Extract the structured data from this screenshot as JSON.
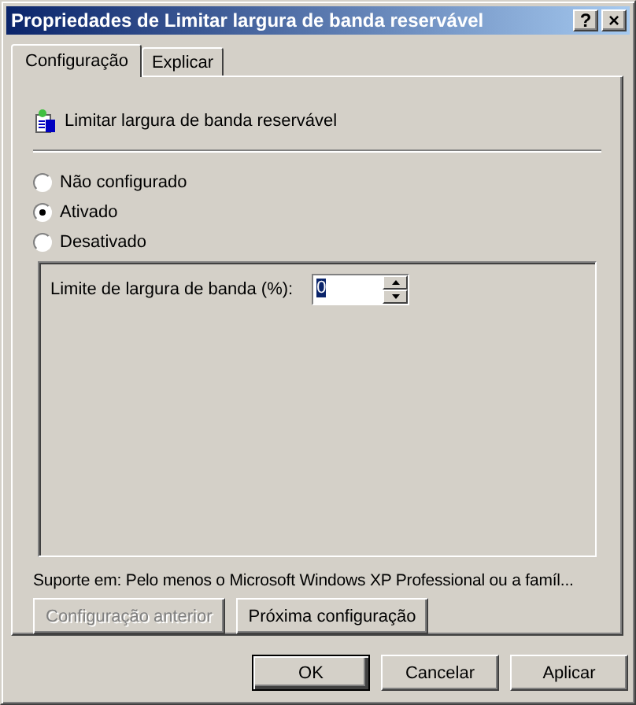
{
  "window": {
    "title": "Propriedades de Limitar largura de banda reservável",
    "help_button": "?",
    "close_button": "×"
  },
  "tabs": [
    {
      "label": "Configuração",
      "selected": true
    },
    {
      "label": "Explicar",
      "selected": false
    }
  ],
  "heading": "Limitar largura de banda reservável",
  "options": [
    {
      "label": "Não configurado",
      "selected": false
    },
    {
      "label": "Ativado",
      "selected": true
    },
    {
      "label": "Desativado",
      "selected": false
    }
  ],
  "limit": {
    "label": "Limite de largura de banda (%):",
    "value": "0"
  },
  "support_text": "Suporte em: Pelo menos o Microsoft Windows XP Professional ou a famíl...",
  "nav_buttons": [
    {
      "label": "Configuração anterior",
      "disabled": true
    },
    {
      "label": "Próxima configuração",
      "disabled": false
    }
  ],
  "buttons": [
    {
      "label": "OK",
      "default": true
    },
    {
      "label": "Cancelar",
      "default": false
    },
    {
      "label": "Aplicar",
      "default": false
    }
  ]
}
